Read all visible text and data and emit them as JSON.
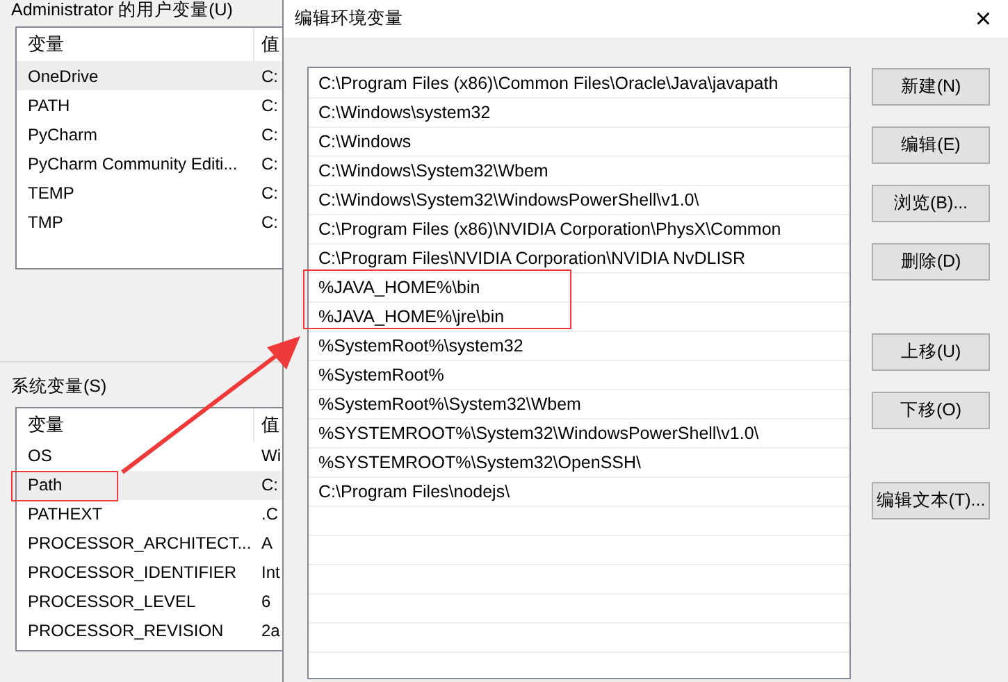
{
  "user_vars": {
    "title": "Administrator 的用户变量(U)",
    "columns": [
      "变量",
      "值"
    ],
    "rows": [
      {
        "name": "OneDrive",
        "value": "C:",
        "selected": true
      },
      {
        "name": "PATH",
        "value": "C:",
        "selected": false
      },
      {
        "name": "PyCharm",
        "value": "C:",
        "selected": false
      },
      {
        "name": "PyCharm Community Editi...",
        "value": "C:",
        "selected": false
      },
      {
        "name": "TEMP",
        "value": "C:",
        "selected": false
      },
      {
        "name": "TMP",
        "value": "C:",
        "selected": false
      }
    ]
  },
  "system_vars": {
    "title": "系统变量(S)",
    "columns": [
      "变量",
      "值"
    ],
    "rows": [
      {
        "name": "OS",
        "value": "Wi",
        "selected": false
      },
      {
        "name": "Path",
        "value": "C:",
        "selected": true
      },
      {
        "name": "PATHEXT",
        "value": ".C",
        "selected": false
      },
      {
        "name": "PROCESSOR_ARCHITECT...",
        "value": "A",
        "selected": false
      },
      {
        "name": "PROCESSOR_IDENTIFIER",
        "value": "Int",
        "selected": false
      },
      {
        "name": "PROCESSOR_LEVEL",
        "value": "6",
        "selected": false
      },
      {
        "name": "PROCESSOR_REVISION",
        "value": "2a",
        "selected": false
      }
    ]
  },
  "dialog": {
    "title": "编辑环境变量",
    "close": "×",
    "entries": [
      "C:\\Program Files (x86)\\Common Files\\Oracle\\Java\\javapath",
      "C:\\Windows\\system32",
      "C:\\Windows",
      "C:\\Windows\\System32\\Wbem",
      "C:\\Windows\\System32\\WindowsPowerShell\\v1.0\\",
      "C:\\Program Files (x86)\\NVIDIA Corporation\\PhysX\\Common",
      "C:\\Program Files\\NVIDIA Corporation\\NVIDIA NvDLISR",
      "%JAVA_HOME%\\bin",
      "%JAVA_HOME%\\jre\\bin",
      "%SystemRoot%\\system32",
      "%SystemRoot%",
      "%SystemRoot%\\System32\\Wbem",
      "%SYSTEMROOT%\\System32\\WindowsPowerShell\\v1.0\\",
      "%SYSTEMROOT%\\System32\\OpenSSH\\",
      "C:\\Program Files\\nodejs\\"
    ],
    "button_groups": [
      [
        "新建(N)",
        "编辑(E)",
        "浏览(B)...",
        "删除(D)"
      ],
      [
        "上移(U)",
        "下移(O)"
      ],
      [
        "编辑文本(T)..."
      ]
    ]
  }
}
